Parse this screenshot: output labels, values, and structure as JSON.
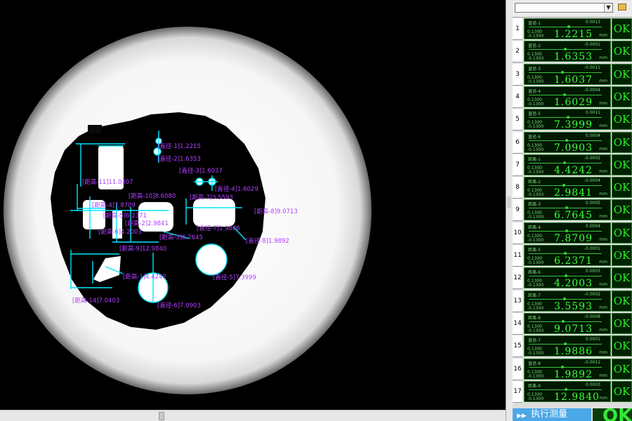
{
  "viewer": {
    "annotations": [
      "[直径-1]1.2215",
      "[直径-2]1.6353",
      "[直径-3]1.6037",
      "[直径-4]1.6029",
      "[距高-11]11.0307",
      "[距高-10]8.6080",
      "[距高-7]3.5593",
      "[距高-4]7.8709",
      "[距高-8]9.0713",
      "[距高-5]6.2371",
      "[距高-2]2.9841",
      "[距高-6]4.2003",
      "[直径-7]1.9886",
      "[距高-3]6.7645",
      "[直径-8]1.9892",
      "[距高-9]12.9840",
      "[直径-5]7.3999",
      "[距高-1]4.4242",
      "[距高-14]7.0403",
      "[直径-6]7.0903"
    ]
  },
  "panel": {
    "rows": [
      {
        "num": "1",
        "label": "直径-1",
        "dev": "0.0013",
        "tol_plus": "0.1300",
        "tol_minus": "-0.1300",
        "value": "1.2215",
        "unit": "mm",
        "status": "OK",
        "pos": 0.55
      },
      {
        "num": "2",
        "label": "直径-2",
        "dev": "-0.0001",
        "tol_plus": "0.1300",
        "tol_minus": "-0.1300",
        "value": "1.6353",
        "unit": "mm",
        "status": "OK",
        "pos": 0.5
      },
      {
        "num": "3",
        "label": "直径-3",
        "dev": "-0.0011",
        "tol_plus": "0.1300",
        "tol_minus": "-0.1300",
        "value": "1.6037",
        "unit": "mm",
        "status": "OK",
        "pos": 0.46
      },
      {
        "num": "4",
        "label": "直径-4",
        "dev": "-0.0004",
        "tol_plus": "0.1300",
        "tol_minus": "-0.1300",
        "value": "1.6029",
        "unit": "mm",
        "status": "OK",
        "pos": 0.49
      },
      {
        "num": "5",
        "label": "直径-5",
        "dev": "0.0011",
        "tol_plus": "0.1300",
        "tol_minus": "-0.1300",
        "value": "7.3999",
        "unit": "mm",
        "status": "OK",
        "pos": 0.54
      },
      {
        "num": "6",
        "label": "直径-6",
        "dev": "0.0004",
        "tol_plus": "0.1300",
        "tol_minus": "-0.1300",
        "value": "7.0903",
        "unit": "mm",
        "status": "OK",
        "pos": 0.52
      },
      {
        "num": "7",
        "label": "距离-1",
        "dev": "-0.0002",
        "tol_plus": "0.1300",
        "tol_minus": "-0.1300",
        "value": "4.4242",
        "unit": "mm",
        "status": "OK",
        "pos": 0.49
      },
      {
        "num": "8",
        "label": "距离-2",
        "dev": "-0.0004",
        "tol_plus": "0.1300",
        "tol_minus": "-0.1300",
        "value": "2.9841",
        "unit": "mm",
        "status": "OK",
        "pos": 0.48
      },
      {
        "num": "9",
        "label": "距离-3",
        "dev": "0.0005",
        "tol_plus": "0.1300",
        "tol_minus": "-0.1300",
        "value": "6.7645",
        "unit": "mm",
        "status": "OK",
        "pos": 0.52
      },
      {
        "num": "10",
        "label": "距离-4",
        "dev": "0.0004",
        "tol_plus": "0.1300",
        "tol_minus": "-0.1300",
        "value": "7.8709",
        "unit": "mm",
        "status": "OK",
        "pos": 0.52
      },
      {
        "num": "11",
        "label": "距离-5",
        "dev": "-0.0001",
        "tol_plus": "0.1300",
        "tol_minus": "-0.1300",
        "value": "6.2371",
        "unit": "mm",
        "status": "OK",
        "pos": 0.5
      },
      {
        "num": "12",
        "label": "距离-6",
        "dev": "0.0003",
        "tol_plus": "0.1300",
        "tol_minus": "-0.1300",
        "value": "4.2003",
        "unit": "mm",
        "status": "OK",
        "pos": 0.51
      },
      {
        "num": "13",
        "label": "距离-7",
        "dev": "-0.0002",
        "tol_plus": "0.1300",
        "tol_minus": "-0.1300",
        "value": "3.5593",
        "unit": "mm",
        "status": "OK",
        "pos": 0.49
      },
      {
        "num": "14",
        "label": "距离-8",
        "dev": "-0.0008",
        "tol_plus": "0.1300",
        "tol_minus": "-0.1300",
        "value": "9.0713",
        "unit": "mm",
        "status": "OK",
        "pos": 0.47
      },
      {
        "num": "15",
        "label": "直径-7",
        "dev": "0.0001",
        "tol_plus": "0.1300",
        "tol_minus": "-0.1300",
        "value": "1.9886",
        "unit": "mm",
        "status": "OK",
        "pos": 0.5
      },
      {
        "num": "16",
        "label": "直径-8",
        "dev": "-0.0011",
        "tol_plus": "0.1300",
        "tol_minus": "-0.1300",
        "value": "1.9892",
        "unit": "mm",
        "status": "OK",
        "pos": 0.46
      },
      {
        "num": "17",
        "label": "距离-9",
        "dev": "0.0003",
        "tol_plus": "0.1300",
        "tol_minus": "-0.1300",
        "value": "12.9840",
        "unit": "mm",
        "status": "OK",
        "pos": 0.51
      }
    ],
    "run_button": "执行测量",
    "overall_status": "OK"
  },
  "colors": {
    "annotation": "#b040ff",
    "overlay": "#00e5ff",
    "value_green": "#3dff3d"
  }
}
